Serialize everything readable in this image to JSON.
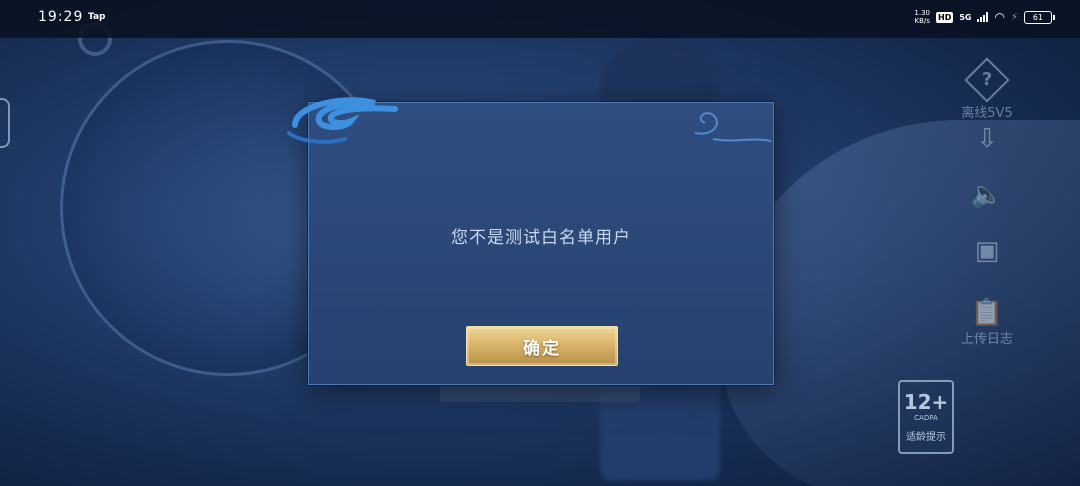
{
  "status_bar": {
    "time": "19:29",
    "app_tag": "Tap",
    "speed_value": "1.30",
    "speed_unit": "KB/s",
    "hd_badge": "HD",
    "network": "5G",
    "battery": "61"
  },
  "background": {
    "right_rail": {
      "help_label": "离线5V5",
      "upload_log_label": "上传日志"
    },
    "age_rating": {
      "number": "12+",
      "org": "CADPA",
      "tip": "适龄提示"
    }
  },
  "dialog": {
    "message": "您不是测试白名单用户",
    "confirm_label": "确定"
  },
  "colors": {
    "dialog_bg": "#2a4777",
    "dialog_border": "#4e79b3",
    "button_gold": "#d9b56a",
    "message_text": "#c9d8f0"
  }
}
